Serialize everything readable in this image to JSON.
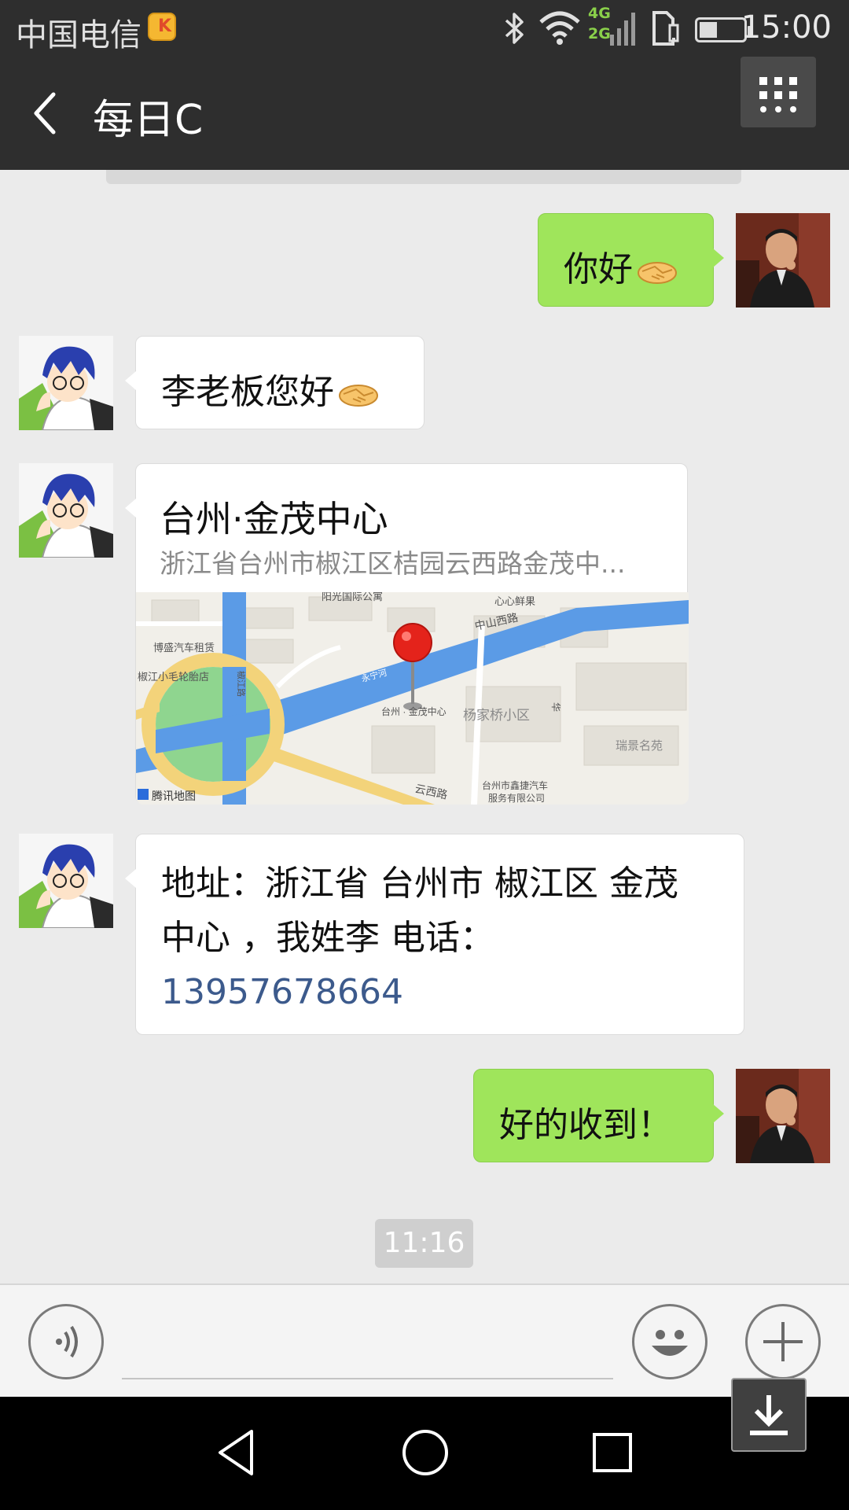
{
  "status_bar": {
    "carrier": "中国电信",
    "network_badge_top": "4G",
    "network_badge_bottom": "2G",
    "time": "15:00",
    "battery_level_fraction": 0.4
  },
  "header": {
    "title": "每日C",
    "back_icon": "chevron-left-icon",
    "more_icon": "grid-menu-icon"
  },
  "messages": [
    {
      "side": "right",
      "text": "你好",
      "emoji": "handshake-emoji"
    },
    {
      "side": "left",
      "text": "李老板您好",
      "emoji": "handshake-emoji"
    },
    {
      "side": "left",
      "type": "location",
      "name": "台州·金茂中心",
      "address": "浙江省台州市椒江区桔园云西路金茂中...",
      "map": {
        "labels": {
          "poi_1": "阳光国际公寓",
          "poi_2": "心心鲜果",
          "road_1": "中山西路",
          "poi_3": "博盛汽车租赁",
          "poi_4": "椒江小毛轮胎店",
          "river": "永宁河",
          "pin_label": "台州 · 金茂中心",
          "district": "杨家桥小区",
          "road_2": "云西路",
          "poi_5": "瑞景名苑",
          "poi_6_line1": "台州市鑫捷汽车",
          "poi_6_line2": "服务有限公司",
          "brand": "腾讯地图",
          "road_3": "椒江路",
          "road_4": "华"
        },
        "colors": {
          "water": "#5b9be6",
          "green": "#8fd58f",
          "road": "#f3d37a",
          "land": "#f1efe9"
        }
      }
    },
    {
      "side": "left",
      "type": "multiline",
      "line1": "地址：浙江省 台州市 椒江区 金茂",
      "line2": "中心 ，我姓李 电话：",
      "phone": "13957678664"
    },
    {
      "side": "right",
      "text": "好的收到！"
    }
  ],
  "timestamp": "11:16",
  "input_bar": {
    "voice_icon": "voice-icon",
    "emoji_icon": "smiley-icon",
    "plus_icon": "plus-icon",
    "input_value": ""
  },
  "nav_bar": {
    "back_icon": "triangle-back-icon",
    "home_icon": "circle-home-icon",
    "recents_icon": "square-recents-icon",
    "download_icon": "download-icon"
  },
  "colors": {
    "bubble_right": "#9fe55b",
    "bubble_left": "#ffffff",
    "background": "#ebebeb",
    "bar": "#2e2e2e",
    "phone_link": "#3c5a8c"
  }
}
